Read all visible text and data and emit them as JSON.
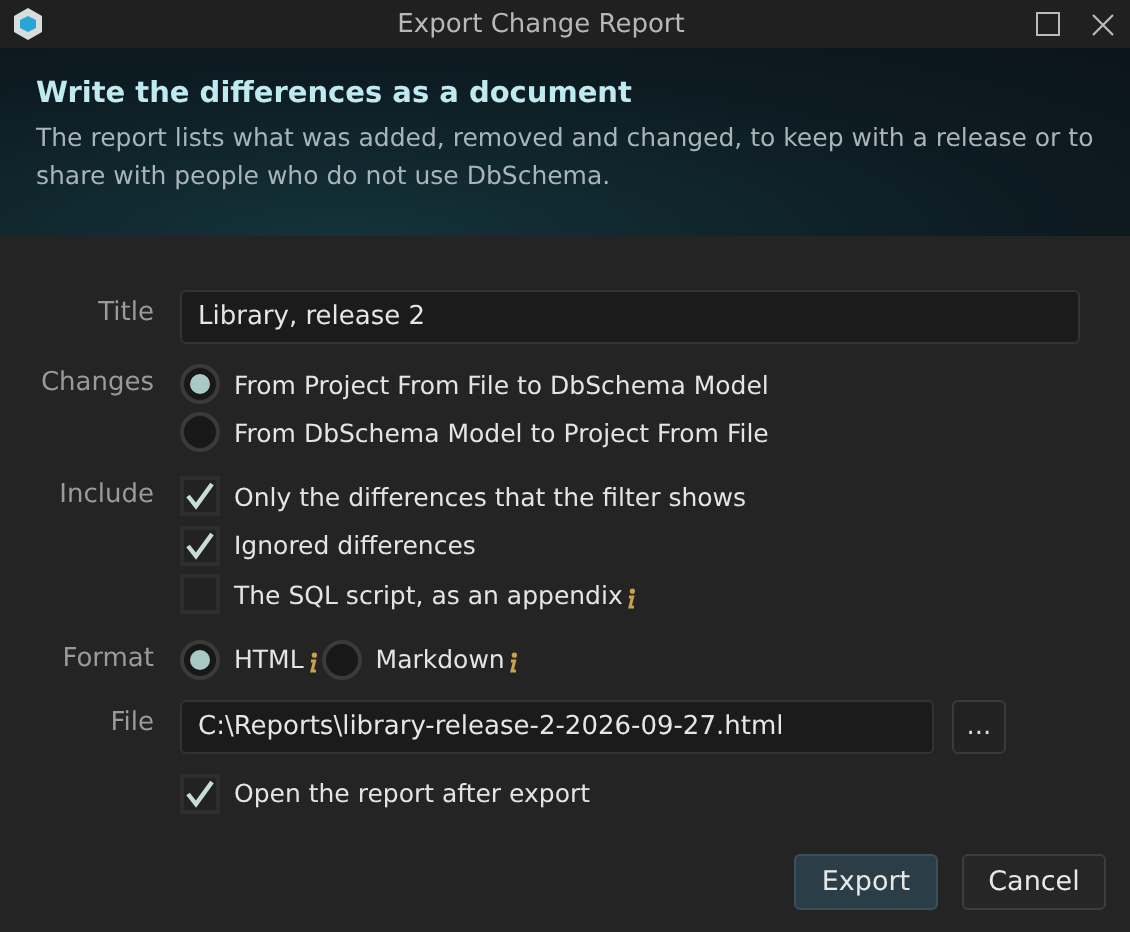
{
  "window": {
    "title": "Export Change Report"
  },
  "header": {
    "heading": "Write the differences as a document",
    "description": "The report lists what was added, removed and changed, to keep with a release or to share with people who do not use DbSchema."
  },
  "title_field": {
    "label": "Title",
    "value": "Library, release 2"
  },
  "changes": {
    "label": "Changes",
    "options": [
      {
        "label": "From Project From File to DbSchema Model",
        "selected": true
      },
      {
        "label": "From DbSchema Model to Project From File",
        "selected": false
      }
    ]
  },
  "include": {
    "label": "Include",
    "options": [
      {
        "label": "Only the differences that the filter shows",
        "checked": true,
        "info": false
      },
      {
        "label": "Ignored differences",
        "checked": true,
        "info": false
      },
      {
        "label": "The SQL script, as an appendix",
        "checked": false,
        "info": true
      }
    ]
  },
  "format": {
    "label": "Format",
    "options": [
      {
        "label": "HTML",
        "selected": true,
        "info": true
      },
      {
        "label": "Markdown",
        "selected": false,
        "info": true
      }
    ]
  },
  "file_field": {
    "label": "File",
    "value": "C:\\Reports\\library-release-2-2026-09-27.html",
    "browse": "..."
  },
  "open_after": {
    "label": "Open the report after export",
    "checked": true
  },
  "buttons": [
    {
      "label": "Export",
      "kind": "primary"
    },
    {
      "label": "Cancel",
      "kind": "secondary"
    }
  ]
}
